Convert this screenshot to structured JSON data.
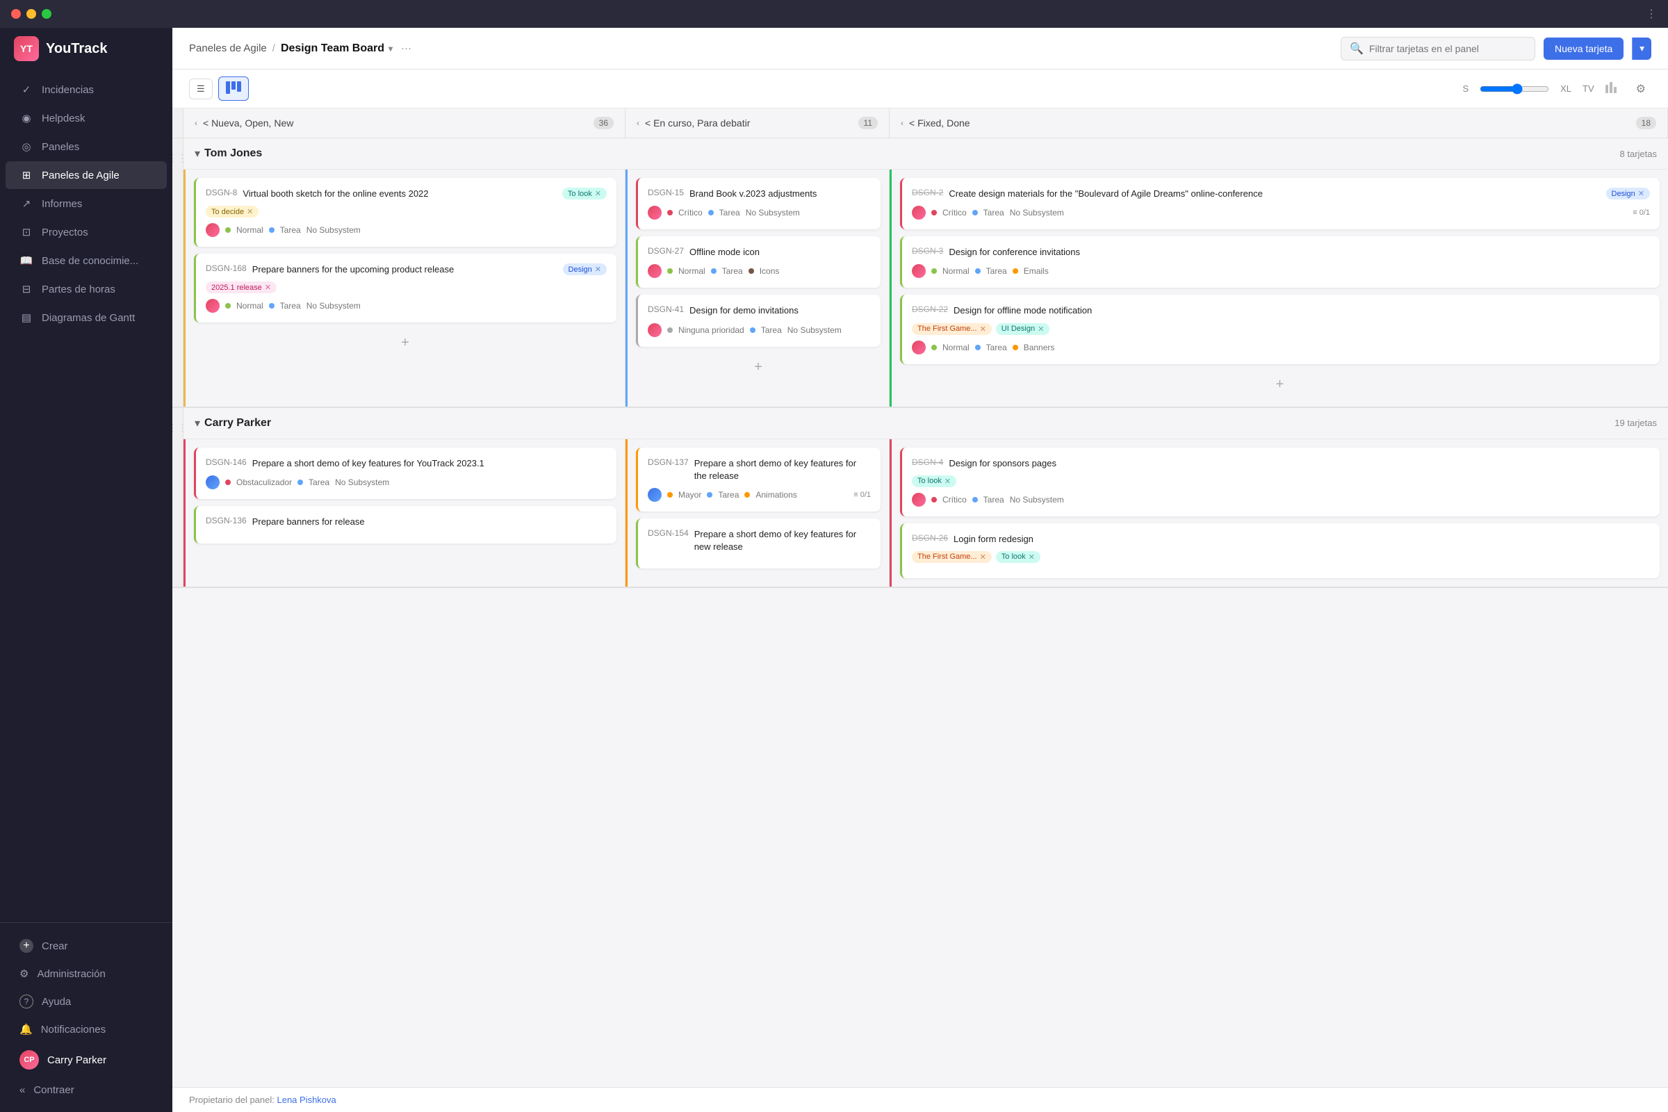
{
  "chrome": {
    "dots": [
      "red",
      "yellow",
      "green"
    ],
    "more_icon": "⋮"
  },
  "sidebar": {
    "logo_text": "YT",
    "title": "YouTrack",
    "nav_items": [
      {
        "id": "incidencias",
        "label": "Incidencias",
        "icon": "✓"
      },
      {
        "id": "helpdesk",
        "label": "Helpdesk",
        "icon": "○"
      },
      {
        "id": "paneles",
        "label": "Paneles",
        "icon": "◎"
      },
      {
        "id": "paneles-agile",
        "label": "Paneles de Agile",
        "icon": "⊞"
      },
      {
        "id": "informes",
        "label": "Informes",
        "icon": "↗"
      },
      {
        "id": "proyectos",
        "label": "Proyectos",
        "icon": "⊡"
      },
      {
        "id": "base",
        "label": "Base de conocimie...",
        "icon": "📖"
      },
      {
        "id": "partes",
        "label": "Partes de horas",
        "icon": "⊟"
      },
      {
        "id": "diagramas",
        "label": "Diagramas de Gantt",
        "icon": "▤"
      }
    ],
    "bottom_items": [
      {
        "id": "crear",
        "label": "Crear",
        "icon": "+"
      },
      {
        "id": "admin",
        "label": "Administración",
        "icon": "⚙"
      },
      {
        "id": "ayuda",
        "label": "Ayuda",
        "icon": "?"
      },
      {
        "id": "notif",
        "label": "Notificaciones",
        "icon": "🔔"
      }
    ],
    "user": {
      "name": "Carry Parker",
      "avatar_initials": "CP"
    },
    "collapse_label": "Contraer"
  },
  "topbar": {
    "breadcrumb_parent": "Paneles de Agile",
    "breadcrumb_separator": "/",
    "board_name": "Design Team Board",
    "search_placeholder": "Filtrar tarjetas en el panel",
    "new_ticket_label": "Nueva tarjeta"
  },
  "toolbar": {
    "list_view_label": "",
    "board_view_label": "",
    "size_min": "S",
    "size_max": "XL",
    "size_tv": "TV",
    "chart_icon": "📊",
    "settings_icon": "⚙"
  },
  "columns": [
    {
      "id": "col1",
      "label": "< Nueva, Open, New",
      "count": 36
    },
    {
      "id": "col2",
      "label": "< En curso, Para debatir",
      "count": 11
    },
    {
      "id": "col3",
      "label": "< Fixed, Done",
      "count": 18
    }
  ],
  "swimlanes": [
    {
      "id": "tom-jones",
      "name": "Tom Jones",
      "count_label": "8 tarjetas",
      "cols": [
        {
          "cards": [
            {
              "id": "DSGN-8",
              "title": "Virtual booth sketch for the online events 2022",
              "strikethrough": false,
              "priority_class": "priority-normal",
              "tags": [
                {
                  "label": "To look",
                  "class": "tag-teal",
                  "has_x": true
                },
                {
                  "label": "To decide",
                  "class": "tag-yellow",
                  "has_x": true
                }
              ],
              "meta": {
                "priority": "Normal",
                "priority_dot": "dot-green",
                "type": "Tarea",
                "subsystem": "No Subsystem"
              }
            },
            {
              "id": "DSGN-168",
              "title": "Prepare banners for the upcoming product release",
              "strikethrough": false,
              "priority_class": "priority-normal",
              "tags": [
                {
                  "label": "Design",
                  "class": "tag-blue",
                  "has_x": true
                },
                {
                  "label": "2025.1 release",
                  "class": "tag-pink",
                  "has_x": true
                }
              ],
              "meta": {
                "priority": "Normal",
                "priority_dot": "dot-green",
                "type": "Tarea",
                "subsystem": "No Subsystem"
              }
            }
          ]
        },
        {
          "cards": [
            {
              "id": "DSGN-15",
              "title": "Brand Book v.2023 adjustments",
              "strikethrough": false,
              "priority_class": "priority-critical",
              "tags": [],
              "meta": {
                "priority": "Crítico",
                "priority_dot": "dot-red",
                "type": "Tarea",
                "subsystem": "No Subsystem"
              }
            },
            {
              "id": "DSGN-27",
              "title": "Offline mode icon",
              "strikethrough": false,
              "priority_class": "priority-normal",
              "tags": [],
              "meta": {
                "priority": "Normal",
                "priority_dot": "dot-green",
                "type": "Tarea",
                "subsystem": "Icons"
              }
            },
            {
              "id": "DSGN-41",
              "title": "Design for demo invitations",
              "strikethrough": false,
              "priority_class": "priority-none",
              "tags": [],
              "meta": {
                "priority": "Ninguna prioridad",
                "priority_dot": "dot-gray",
                "type": "Tarea",
                "subsystem": "No Subsystem"
              }
            }
          ]
        },
        {
          "cards": [
            {
              "id": "DSGN-2",
              "title": "Create design materials for the \"Boulevard of Agile Dreams\" online-conference",
              "strikethrough": true,
              "priority_class": "priority-critical",
              "tags": [
                {
                  "label": "Design",
                  "class": "tag-blue",
                  "has_x": true
                }
              ],
              "meta": {
                "priority": "Crítico",
                "priority_dot": "dot-red",
                "type": "Tarea",
                "subsystem": "No Subsystem",
                "counter": "0/1"
              }
            },
            {
              "id": "DSGN-3",
              "title": "Design for conference invitations",
              "strikethrough": true,
              "priority_class": "priority-normal",
              "tags": [],
              "meta": {
                "priority": "Normal",
                "priority_dot": "dot-green",
                "type": "Tarea",
                "subsystem": "Emails"
              }
            },
            {
              "id": "DSGN-22",
              "title": "Design for offline mode notification",
              "strikethrough": true,
              "priority_class": "priority-normal",
              "tags": [
                {
                  "label": "The First Game...",
                  "class": "tag-orange",
                  "has_x": true
                },
                {
                  "label": "UI Design",
                  "class": "tag-teal",
                  "has_x": true
                }
              ],
              "meta": {
                "priority": "Normal",
                "priority_dot": "dot-green",
                "type": "Tarea",
                "subsystem": "Banners"
              }
            }
          ]
        }
      ]
    },
    {
      "id": "carry-parker",
      "name": "Carry Parker",
      "count_label": "19 tarjetas",
      "cols": [
        {
          "cards": [
            {
              "id": "DSGN-146",
              "title": "Prepare a short demo of key features for YouTrack 2023.1",
              "strikethrough": false,
              "priority_class": "priority-blocker",
              "tags": [],
              "meta": {
                "priority": "Obstaculizador",
                "priority_dot": "dot-red",
                "type": "Tarea",
                "subsystem": "No Subsystem"
              }
            },
            {
              "id": "DSGN-136",
              "title": "Prepare banners for release",
              "strikethrough": false,
              "priority_class": "priority-normal",
              "tags": [],
              "meta": {}
            }
          ]
        },
        {
          "cards": [
            {
              "id": "DSGN-137",
              "title": "Prepare a short demo of key features for the release",
              "strikethrough": false,
              "priority_class": "priority-major",
              "tags": [],
              "meta": {
                "priority": "Mayor",
                "priority_dot": "dot-yellow",
                "type": "Tarea",
                "subsystem": "Animations",
                "counter": "0/1"
              }
            },
            {
              "id": "DSGN-154",
              "title": "Prepare a short demo of key features for new release",
              "strikethrough": false,
              "priority_class": "priority-normal",
              "tags": [],
              "meta": {}
            }
          ]
        },
        {
          "cards": [
            {
              "id": "DSGN-4",
              "title": "Design for sponsors pages",
              "strikethrough": true,
              "priority_class": "priority-critical",
              "tags": [
                {
                  "label": "To look",
                  "class": "tag-teal",
                  "has_x": true
                }
              ],
              "meta": {
                "priority": "Crítico",
                "priority_dot": "dot-red",
                "type": "Tarea",
                "subsystem": "No Subsystem"
              }
            },
            {
              "id": "DSGN-26",
              "title": "Login form redesign",
              "strikethrough": true,
              "priority_class": "priority-normal",
              "tags": [
                {
                  "label": "The First Game...",
                  "class": "tag-orange",
                  "has_x": true
                },
                {
                  "label": "To look",
                  "class": "tag-teal",
                  "has_x": true
                }
              ],
              "meta": {}
            }
          ]
        }
      ]
    }
  ],
  "footer": {
    "label": "Propietario del panel:",
    "owner": "Lena Pishkova"
  }
}
